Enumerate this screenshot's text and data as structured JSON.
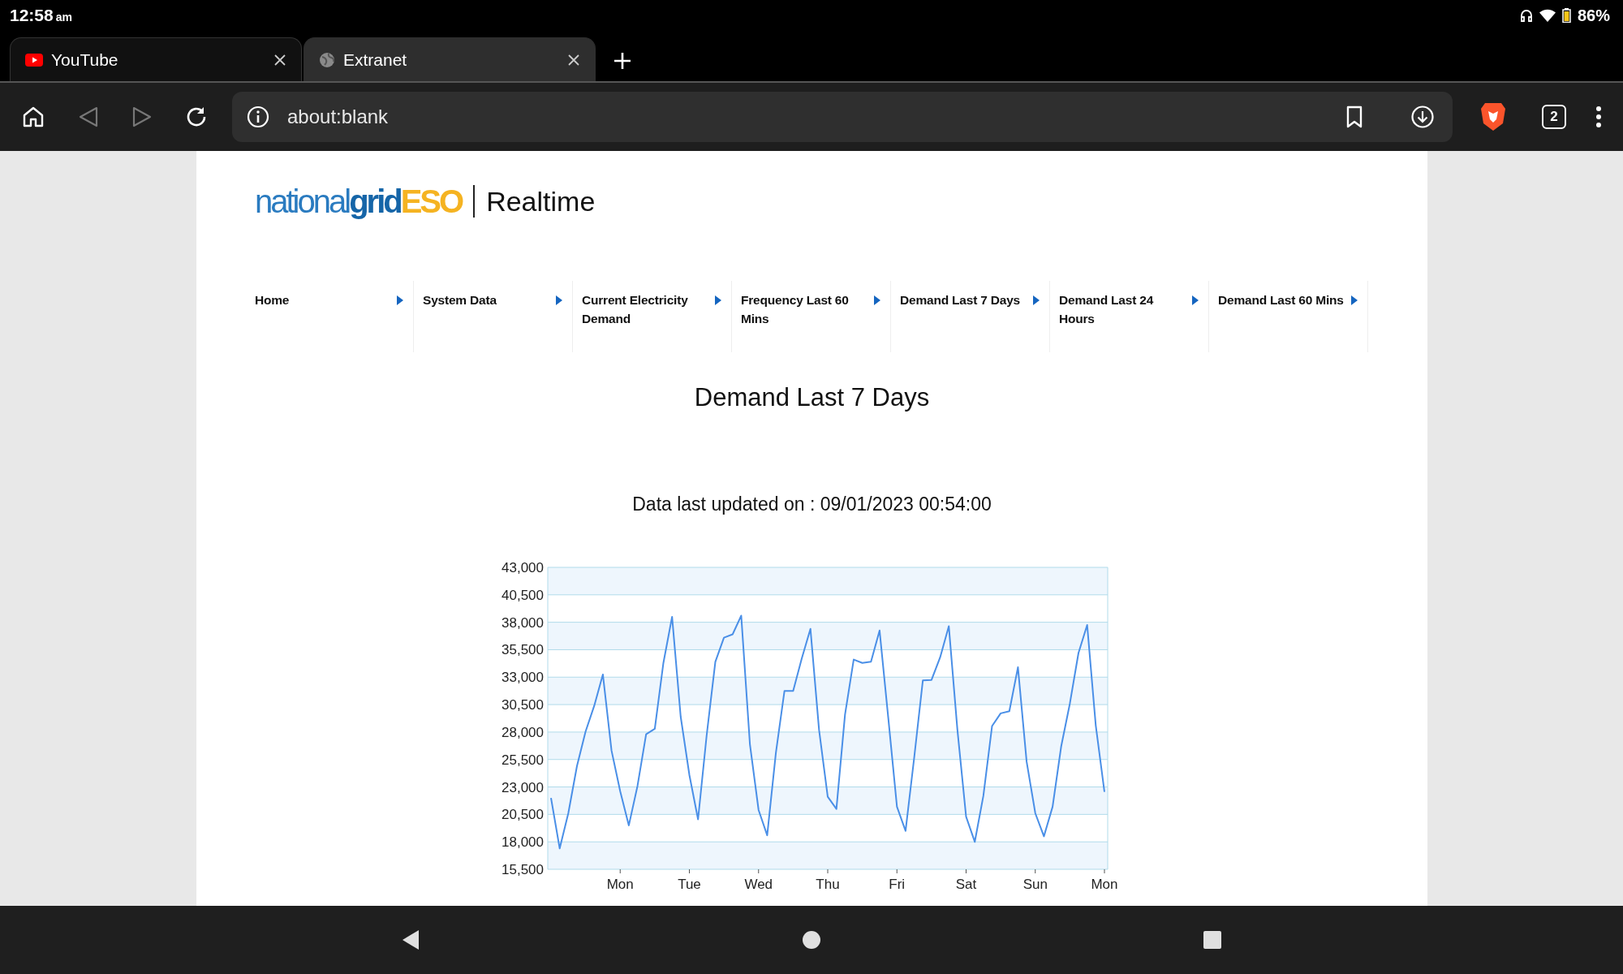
{
  "status_bar": {
    "time": "12:58",
    "ampm": "am",
    "battery": "86%"
  },
  "tabs": [
    {
      "title": "YouTube",
      "kind": "video",
      "selected": false
    },
    {
      "title": "Extranet",
      "kind": "globe",
      "selected": true
    }
  ],
  "toolbar": {
    "buttons": [
      {
        "kind": "home",
        "disabled": false
      },
      {
        "kind": "back",
        "disabled": true
      },
      {
        "kind": "forward",
        "disabled": true
      },
      {
        "kind": "reload",
        "disabled": false
      }
    ],
    "url": "about:blank",
    "tab_count": "2"
  },
  "logo": {
    "words": [
      {
        "text": "national",
        "kind": "light"
      },
      {
        "text": "grid",
        "kind": "bold"
      },
      {
        "text": "ESO",
        "kind": "accent"
      }
    ],
    "subtitle": "Realtime"
  },
  "nav": [
    {
      "label": "Home"
    },
    {
      "label": "System Data"
    },
    {
      "label": "Current Electricity Demand"
    },
    {
      "label": "Frequency Last 60 Mins"
    },
    {
      "label": "Demand Last 7 Days"
    },
    {
      "label": "Demand Last 24 Hours"
    },
    {
      "label": "Demand Last 60 Mins"
    }
  ],
  "heading": "Demand Last 7 Days",
  "updated": "Data last updated on : 09/01/2023 00:54:00",
  "chart_data": {
    "type": "line",
    "grid": true,
    "categories": [
      null,
      null,
      null,
      null,
      null,
      null,
      null,
      null,
      "Mon",
      null,
      null,
      null,
      null,
      null,
      null,
      null,
      "Tue",
      null,
      null,
      null,
      null,
      null,
      null,
      null,
      "Wed",
      null,
      null,
      null,
      null,
      null,
      null,
      null,
      "Thu",
      null,
      null,
      null,
      null,
      null,
      null,
      null,
      "Fri",
      null,
      null,
      null,
      null,
      null,
      null,
      null,
      "Sat",
      null,
      null,
      null,
      null,
      null,
      null,
      null,
      "Sun",
      null,
      null,
      null,
      null,
      null,
      null,
      null,
      "Mon"
    ],
    "series": [
      {
        "color": "#4a8fe7",
        "values": [
          22000,
          17400,
          20600,
          24900,
          28050,
          30400,
          33250,
          26300,
          22600,
          19500,
          23100,
          27800,
          28300,
          34300,
          38500,
          29400,
          24100,
          20050,
          27700,
          34400,
          36600,
          36900,
          38600,
          26900,
          20900,
          18600,
          26100,
          31750,
          31750,
          34700,
          37400,
          28200,
          22100,
          21000,
          29600,
          34600,
          34300,
          34400,
          37250,
          29300,
          21200,
          19000,
          25700,
          32700,
          32750,
          34800,
          37650,
          28200,
          20300,
          18000,
          22200,
          28550,
          29700,
          29900,
          33900,
          25300,
          20600,
          18500,
          21200,
          26700,
          30600,
          35200,
          37750,
          28600,
          22550
        ]
      }
    ],
    "ylim": [
      15500,
      43000
    ],
    "yticks": [
      {
        "value": 15500,
        "label": "15,500"
      },
      {
        "value": 18000,
        "label": "18,000"
      },
      {
        "value": 20500,
        "label": "20,500"
      },
      {
        "value": 23000,
        "label": "23,000"
      },
      {
        "value": 25500,
        "label": "25,500"
      },
      {
        "value": 28000,
        "label": "28,000"
      },
      {
        "value": 30500,
        "label": "30,500"
      },
      {
        "value": 33000,
        "label": "33,000"
      },
      {
        "value": 35500,
        "label": "35,500"
      },
      {
        "value": 38000,
        "label": "38,000"
      },
      {
        "value": 40500,
        "label": "40,500"
      },
      {
        "value": 43000,
        "label": "43,000"
      }
    ]
  }
}
